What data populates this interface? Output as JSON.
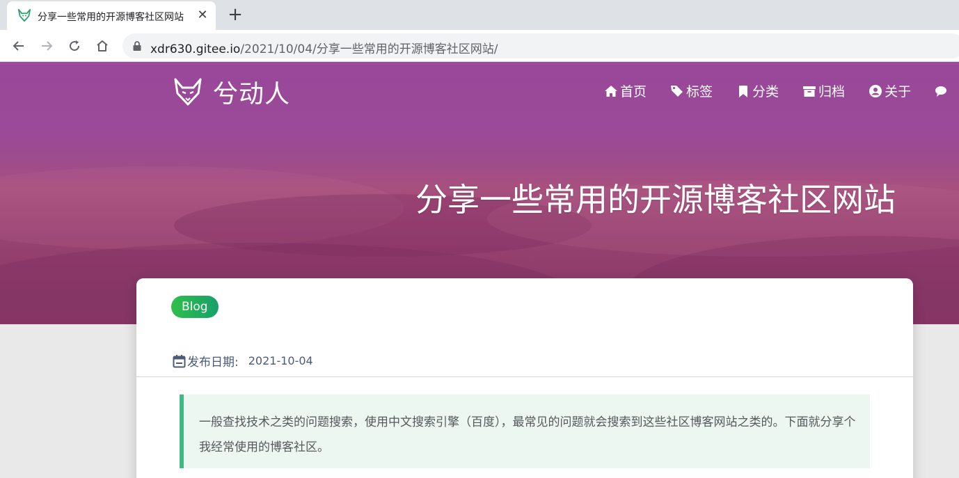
{
  "browser": {
    "tab_title": "分享一些常用的开源博客社区网站",
    "close_glyph": "✕",
    "new_tab_glyph": "+",
    "url_host": "xdr630.gitee.io",
    "url_path": "/2021/10/04/分享一些常用的开源博客社区网站/"
  },
  "site": {
    "name": "兮动人",
    "nav": [
      {
        "label": "首页",
        "icon": "home-icon"
      },
      {
        "label": "标签",
        "icon": "tags-icon"
      },
      {
        "label": "分类",
        "icon": "bookmark-icon"
      },
      {
        "label": "归档",
        "icon": "archive-icon"
      },
      {
        "label": "关于",
        "icon": "user-circle-icon"
      }
    ]
  },
  "post": {
    "title": "分享一些常用的开源博客社区网站",
    "tag": "Blog",
    "date_label": "发布日期:",
    "date_value": "2021-10-04",
    "quote": "一般查找技术之类的问题搜索，使用中文搜索引擎（百度），最常见的问题就会搜索到这些社区博客网站之类的。下面就分享个我经常使用的博客社区。"
  },
  "colors": {
    "hero": "#9a4a97",
    "tag_green": "#2fbf4a",
    "quote_border": "#42b983",
    "quote_bg": "#ebf7f0"
  }
}
